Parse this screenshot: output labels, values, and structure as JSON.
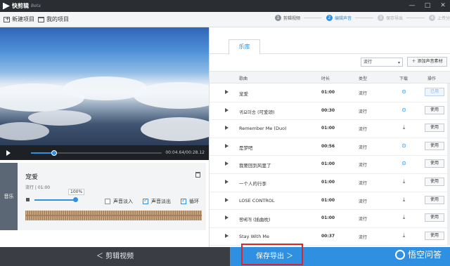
{
  "app": {
    "name": "快剪辑",
    "badge": "Beta"
  },
  "window_controls": [
    "—",
    "□",
    "✕"
  ],
  "toolbar": {
    "new_project": "新建项目",
    "my_projects": "我的项目"
  },
  "steps": [
    {
      "num": "1",
      "label": "剪辑视频",
      "state": "done"
    },
    {
      "num": "2",
      "label": "编辑声音",
      "state": "active"
    },
    {
      "num": "3",
      "label": "保存导出",
      "state": "todo"
    },
    {
      "num": "4",
      "label": "上传分",
      "state": "todo"
    }
  ],
  "player": {
    "time": "00:04.64/00:28.12",
    "progress": 0.18
  },
  "audio_track": {
    "section_label": "音乐",
    "song_title": "宠爱",
    "meta": "流行 | 01:00",
    "volume_label": "100%",
    "volume": 1.0,
    "options": [
      {
        "label": "声音淡入",
        "checked": false
      },
      {
        "label": "声音淡出",
        "checked": true
      },
      {
        "label": "循环",
        "checked": true
      }
    ]
  },
  "library": {
    "tab": "乐库",
    "filter_value": "流行",
    "add_button": "添加声音素材",
    "columns": [
      "歌曲",
      "时长",
      "类型",
      "下载",
      "操作"
    ],
    "songs": [
      {
        "name": "宠爱",
        "duration": "01:00",
        "type": "流行",
        "downloaded": true,
        "action": "已用"
      },
      {
        "name": "귀요미송 (可爱颂)",
        "duration": "00:30",
        "type": "流行",
        "downloaded": true,
        "action": "使用"
      },
      {
        "name": "Remember Me (Duo)",
        "duration": "01:00",
        "type": "流行",
        "downloaded": false,
        "action": "使用"
      },
      {
        "name": "是梦吧",
        "duration": "00:56",
        "type": "流行",
        "downloaded": true,
        "action": "使用"
      },
      {
        "name": "我要回到风里了",
        "duration": "01:00",
        "type": "流行",
        "downloaded": true,
        "action": "使用"
      },
      {
        "name": "一个人的行李",
        "duration": "01:00",
        "type": "流行",
        "downloaded": false,
        "action": "使用"
      },
      {
        "name": "LOSE CONTROL",
        "duration": "01:00",
        "type": "流行",
        "downloaded": false,
        "action": "使用"
      },
      {
        "name": "짱베개 (插曲枕)",
        "duration": "01:00",
        "type": "流行",
        "downloaded": false,
        "action": "使用"
      },
      {
        "name": "Stay With Me",
        "duration": "00:37",
        "type": "流行",
        "downloaded": false,
        "action": "使用"
      }
    ]
  },
  "footer": {
    "back": "＜  剪辑视频",
    "next": "保存导出  ＞"
  },
  "watermark": "悟空问答",
  "colors": {
    "accent": "#2f8fe0",
    "highlight": "#d62828"
  }
}
